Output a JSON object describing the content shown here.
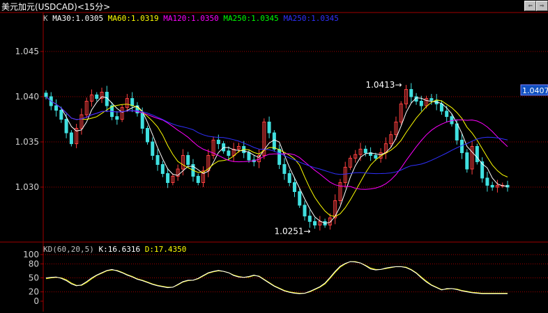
{
  "window": {
    "title": "美元加元(USDCAD)<15分>"
  },
  "nav": {
    "prev_label": "⇦",
    "next_label": "⇨"
  },
  "legend": {
    "prefix": "K",
    "ma30": "MA30:1.0305",
    "ma60": "MA60:1.0319",
    "ma120": "MA120:1.0350",
    "ma250a": "MA250:1.0345",
    "ma250b": "MA250:1.0345"
  },
  "kd_legend": {
    "name": "KD(60,20,5)",
    "k": "K:16.6316",
    "d": "D:17.4350"
  },
  "colors": {
    "ma30": "#ffffff",
    "ma60": "#ffff00",
    "ma120": "#ff00ff",
    "ma250a": "#00ff00",
    "ma250b": "#3030ff",
    "candle_up": "#ff4040",
    "candle_down": "#40e0e0",
    "grid": "#a00000",
    "axis": "#a00000",
    "price_tag": "#1050c0"
  },
  "chart_data": [
    {
      "type": "candlestick",
      "y_ticks": [
        "1.045",
        "1.040",
        "1.035",
        "1.030"
      ],
      "ylim": [
        1.024,
        1.048
      ],
      "current_price": "1.0407",
      "annotations": [
        {
          "label": "1.0413",
          "value": 1.0413
        },
        {
          "label": "1.0251",
          "value": 1.0251
        }
      ],
      "series": {
        "close": [
          1.04,
          1.039,
          1.0385,
          1.0375,
          1.036,
          1.0348,
          1.0365,
          1.038,
          1.0395,
          1.0402,
          1.0398,
          1.0405,
          1.039,
          1.0378,
          1.0375,
          1.0388,
          1.0398,
          1.039,
          1.0382,
          1.0365,
          1.035,
          1.0335,
          1.0325,
          1.0315,
          1.0305,
          1.0312,
          1.032,
          1.0335,
          1.0325,
          1.0312,
          1.0305,
          1.0318,
          1.0335,
          1.0352,
          1.0348,
          1.034,
          1.0335,
          1.0342,
          1.0345,
          1.0338,
          1.033,
          1.0328,
          1.0335,
          1.0372,
          1.036,
          1.0342,
          1.0325,
          1.0315,
          1.0305,
          1.0295,
          1.028,
          1.0268,
          1.0262,
          1.0258,
          1.0262,
          1.0258,
          1.0266,
          1.0285,
          1.0305,
          1.0322,
          1.0332,
          1.0336,
          1.0342,
          1.0338,
          1.0335,
          1.0332,
          1.0338,
          1.0348,
          1.0358,
          1.0372,
          1.0392,
          1.0408,
          1.04,
          1.0395,
          1.039,
          1.0398,
          1.0396,
          1.0392,
          1.0384,
          1.0378,
          1.037,
          1.0352,
          1.0338,
          1.032,
          1.0345,
          1.0328,
          1.031,
          1.0302,
          1.03,
          1.0302,
          1.0302,
          1.03
        ],
        "k": [
          50,
          51,
          52,
          49,
          44,
          37,
          33,
          35,
          42,
          50,
          56,
          61,
          66,
          68,
          65,
          61,
          56,
          52,
          47,
          44,
          40,
          36,
          33,
          31,
          29,
          30,
          36,
          42,
          45,
          45,
          49,
          55,
          61,
          64,
          66,
          64,
          61,
          55,
          52,
          51,
          53,
          56,
          53,
          46,
          39,
          32,
          27,
          22,
          19,
          17,
          16,
          17,
          21,
          26,
          31,
          39,
          51,
          64,
          75,
          81,
          85,
          84,
          82,
          76,
          69,
          67,
          68,
          71,
          73,
          74,
          74,
          72,
          67,
          60,
          50,
          41,
          34,
          29,
          24,
          27,
          27,
          25,
          22,
          20,
          18,
          17,
          16,
          16,
          16,
          16,
          16,
          16
        ],
        "d": [
          48,
          50,
          51,
          50,
          46,
          39,
          34,
          34,
          40,
          48,
          55,
          60,
          65,
          67,
          66,
          62,
          57,
          53,
          48,
          45,
          41,
          37,
          34,
          32,
          30,
          30,
          35,
          41,
          44,
          45,
          48,
          54,
          60,
          63,
          65,
          64,
          61,
          56,
          53,
          51,
          52,
          55,
          54,
          47,
          40,
          33,
          28,
          23,
          20,
          18,
          17,
          17,
          20,
          25,
          30,
          37,
          49,
          62,
          73,
          80,
          85,
          85,
          82,
          77,
          71,
          68,
          68,
          70,
          72,
          74,
          74,
          73,
          68,
          61,
          52,
          43,
          35,
          30,
          25,
          26,
          27,
          26,
          23,
          21,
          19,
          18,
          17,
          17,
          17,
          17,
          17,
          17
        ]
      }
    },
    {
      "type": "line",
      "name": "KD(60,20,5)",
      "y_ticks": [
        "100",
        "80",
        "50",
        "20",
        "0"
      ],
      "ylim": [
        0,
        100
      ]
    }
  ]
}
